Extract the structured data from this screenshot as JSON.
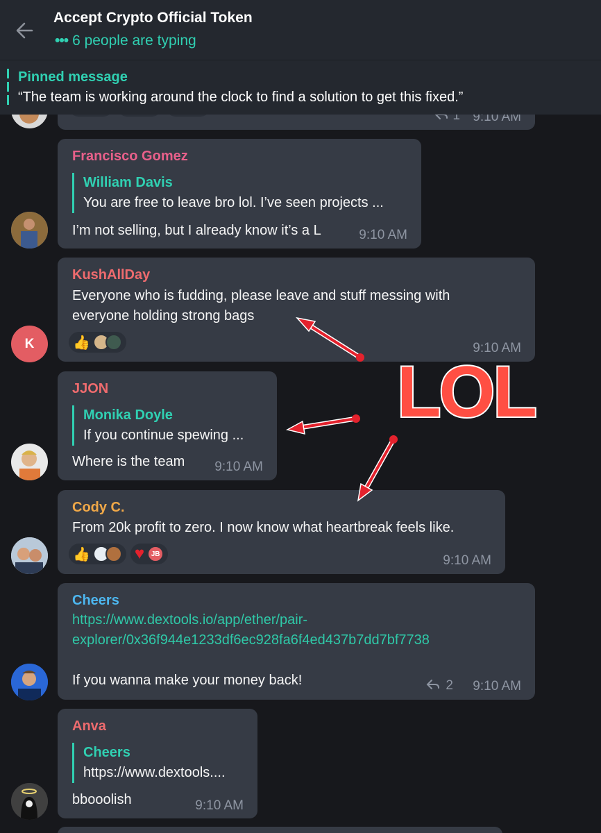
{
  "header": {
    "title": "Accept Crypto Official Token",
    "typing_dots": "•••",
    "typing_text": "6 people are typing"
  },
  "pinned": {
    "title": "Pinned message",
    "text": "“The team is working around the clock to find a solution to get this fixed.”"
  },
  "partial_top": {
    "reply_count": "1",
    "time": "9:10 AM"
  },
  "messages": {
    "m1": {
      "sender": "Francisco Gomez",
      "sender_color": "#e8608a",
      "reply_name": "William Davis",
      "reply_text": "You are free to leave bro lol. I’ve seen projects ...",
      "text": "I’m not selling, but I already know it’s a L",
      "time": "9:10 AM"
    },
    "m2": {
      "sender": "KushAllDay",
      "sender_color": "#ee6b6e",
      "avatar_letter": "K",
      "text_line1": "Everyone who is fudding, please leave and stuff messing with",
      "text_line2": "everyone holding strong bags",
      "reaction_emoji": "👍",
      "time": "9:10 AM"
    },
    "m3": {
      "sender": "JJON",
      "sender_color": "#ee6b6e",
      "reply_name": "Monika Doyle",
      "reply_text": "If you continue spewing ...",
      "text": "Where is the team",
      "time": "9:10 AM"
    },
    "m4": {
      "sender": "Cody C.",
      "sender_color": "#f0a848",
      "text": "From 20k profit to zero. I now know what heartbreak feels like.",
      "reaction1_emoji": "👍",
      "reaction2_emoji": "♥",
      "reaction2_initials": "JB",
      "time": "9:10 AM"
    },
    "m5": {
      "sender": "Cheers",
      "sender_color": "#4db7f0",
      "link_line1": "https://www.dextools.io/app/ether/pair-",
      "link_line2": "explorer/0x36f944e1233df6ec928fa6f4ed437b7dd7bf7738",
      "text": "If you wanna make your money back!",
      "reply_count": "2",
      "time": "9:10 AM"
    },
    "m6": {
      "sender": "Anva",
      "sender_color": "#ee6b6e",
      "reply_name": "Cheers",
      "reply_text": "https://www.dextools....",
      "text": "bbooolish",
      "time": "9:10 AM"
    }
  },
  "annotation": {
    "text": "LOL",
    "color": "#ff4f43"
  },
  "icons": [
    "back-arrow-icon",
    "reply-arrow-icon",
    "thumbs-up-icon",
    "heart-icon"
  ]
}
